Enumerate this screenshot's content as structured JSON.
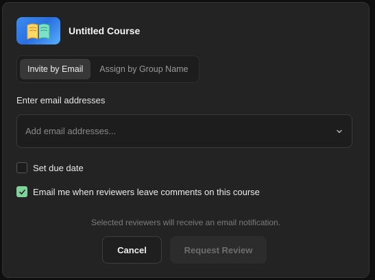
{
  "course": {
    "title": "Untitled Course",
    "icon": "open-book-icon"
  },
  "tabs": [
    {
      "label": "Invite by Email",
      "active": true
    },
    {
      "label": "Assign by Group Name",
      "active": false
    }
  ],
  "email": {
    "label": "Enter email addresses",
    "placeholder": "Add email addresses..."
  },
  "options": {
    "due_date": {
      "label": "Set due date",
      "checked": false
    },
    "notify": {
      "label": "Email me when reviewers leave comments on this course",
      "checked": true
    }
  },
  "note": "Selected reviewers will receive an email notification.",
  "buttons": {
    "cancel": "Cancel",
    "request": "Request Review"
  },
  "colors": {
    "checkbox_checked": "#7fd39a",
    "course_icon_bg": "#3b8df0"
  }
}
